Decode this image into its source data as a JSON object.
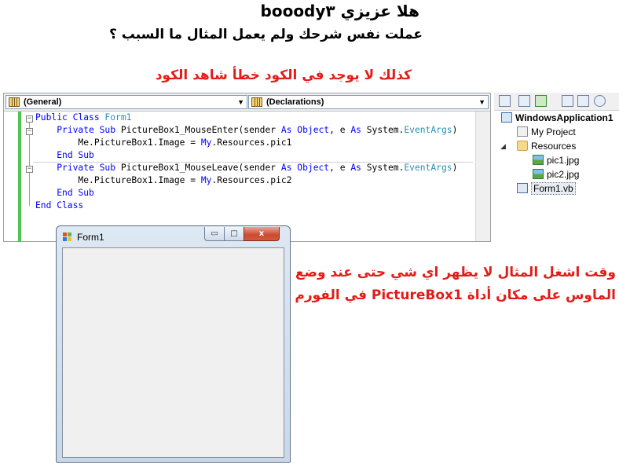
{
  "captions": {
    "line1": "هلا عزيزي booody٣",
    "line2": "عملت نفس شرحك ولم يعمل المثال ما السبب ؟",
    "line3": "كذلك لا يوجد في الكود خطأ شاهد الكود",
    "note_line1": "وقت اشغل المثال لا يظهر اي شي حتى عند وضع",
    "note_line2": "الماوس على مكان أداة PictureBox1 في الفورم"
  },
  "editor": {
    "combo_left": "(General)",
    "combo_right": "(Declarations)",
    "code": {
      "l1_kw": "Public Class ",
      "l1_ty": "Form1",
      "l2_a": "Private Sub ",
      "l2_b": "PictureBox1_MouseEnter(sender ",
      "l2_as1": "As ",
      "l2_obj": "Object",
      "l2_c": ", e ",
      "l2_as2": "As ",
      "l2_sys": "System.",
      "l2_ev": "EventArgs",
      "l2_d": ")",
      "l3_a": "Me.PictureBox1.Image = ",
      "l3_my": "My",
      "l3_b": ".Resources.pic1",
      "l4": "End Sub",
      "l5_a": "Private Sub ",
      "l5_b": "PictureBox1_MouseLeave(sender ",
      "l5_as1": "As ",
      "l5_obj": "Object",
      "l5_c": ", e ",
      "l5_as2": "As ",
      "l5_sys": "System.",
      "l5_ev": "EventArgs",
      "l5_d": ")",
      "l6_a": "Me.PictureBox1.Image = ",
      "l6_my": "My",
      "l6_b": ".Resources.pic2",
      "l7": "End Sub",
      "l8": "End Class"
    }
  },
  "solution_explorer": {
    "items": [
      "WindowsApplication1",
      "My Project",
      "Resources",
      "pic1.jpg",
      "pic2.jpg",
      "Form1.vb"
    ]
  },
  "form_window": {
    "title": "Form1",
    "min_glyph": "▭",
    "max_glyph": "□",
    "close_glyph": "x"
  },
  "colors": {
    "keyword": "#0000ff",
    "type": "#2b91af",
    "red_text": "#e41b17",
    "change_bar": "#4fc24f"
  }
}
